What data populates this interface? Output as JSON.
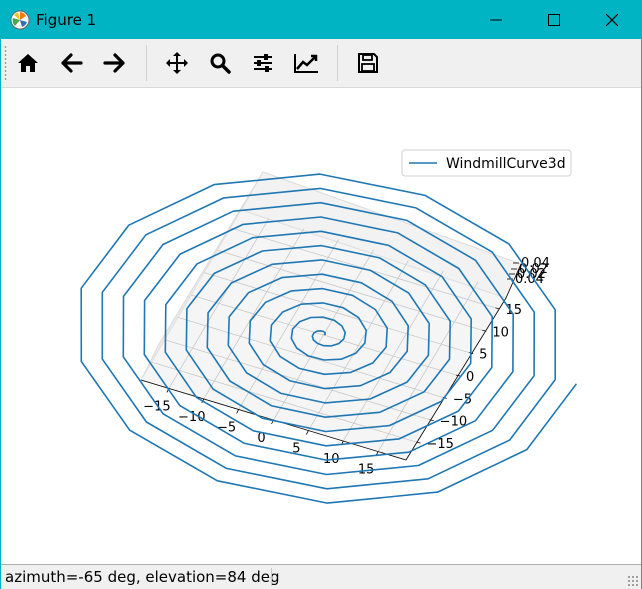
{
  "window": {
    "title": "Figure 1"
  },
  "toolbar": {
    "buttons": [
      {
        "name": "home",
        "icon": "home-icon"
      },
      {
        "name": "back",
        "icon": "arrow-left-icon"
      },
      {
        "name": "forward",
        "icon": "arrow-right-icon"
      },
      {
        "name": "pan",
        "icon": "move-icon"
      },
      {
        "name": "zoom",
        "icon": "magnifier-icon"
      },
      {
        "name": "subplots",
        "icon": "sliders-icon"
      },
      {
        "name": "edit-axes",
        "icon": "line-chart-icon"
      },
      {
        "name": "save",
        "icon": "floppy-disk-icon"
      }
    ]
  },
  "chart_data": {
    "type": "line",
    "projection": "3d",
    "legend": "top-right",
    "series": [
      {
        "name": "WindmillCurve3d",
        "color": "#1f77b4"
      }
    ],
    "xticks": [
      "−15",
      "−10",
      "−5",
      "0",
      "5",
      "10",
      "15"
    ],
    "yticks": [
      "15",
      "10",
      "5",
      "0",
      "−5",
      "−10",
      "−15"
    ],
    "zticks": [
      "0.04",
      "0.02",
      "0.02",
      "0.04"
    ]
  },
  "status": {
    "text": "azimuth=-65 deg, elevation=84 deg"
  }
}
